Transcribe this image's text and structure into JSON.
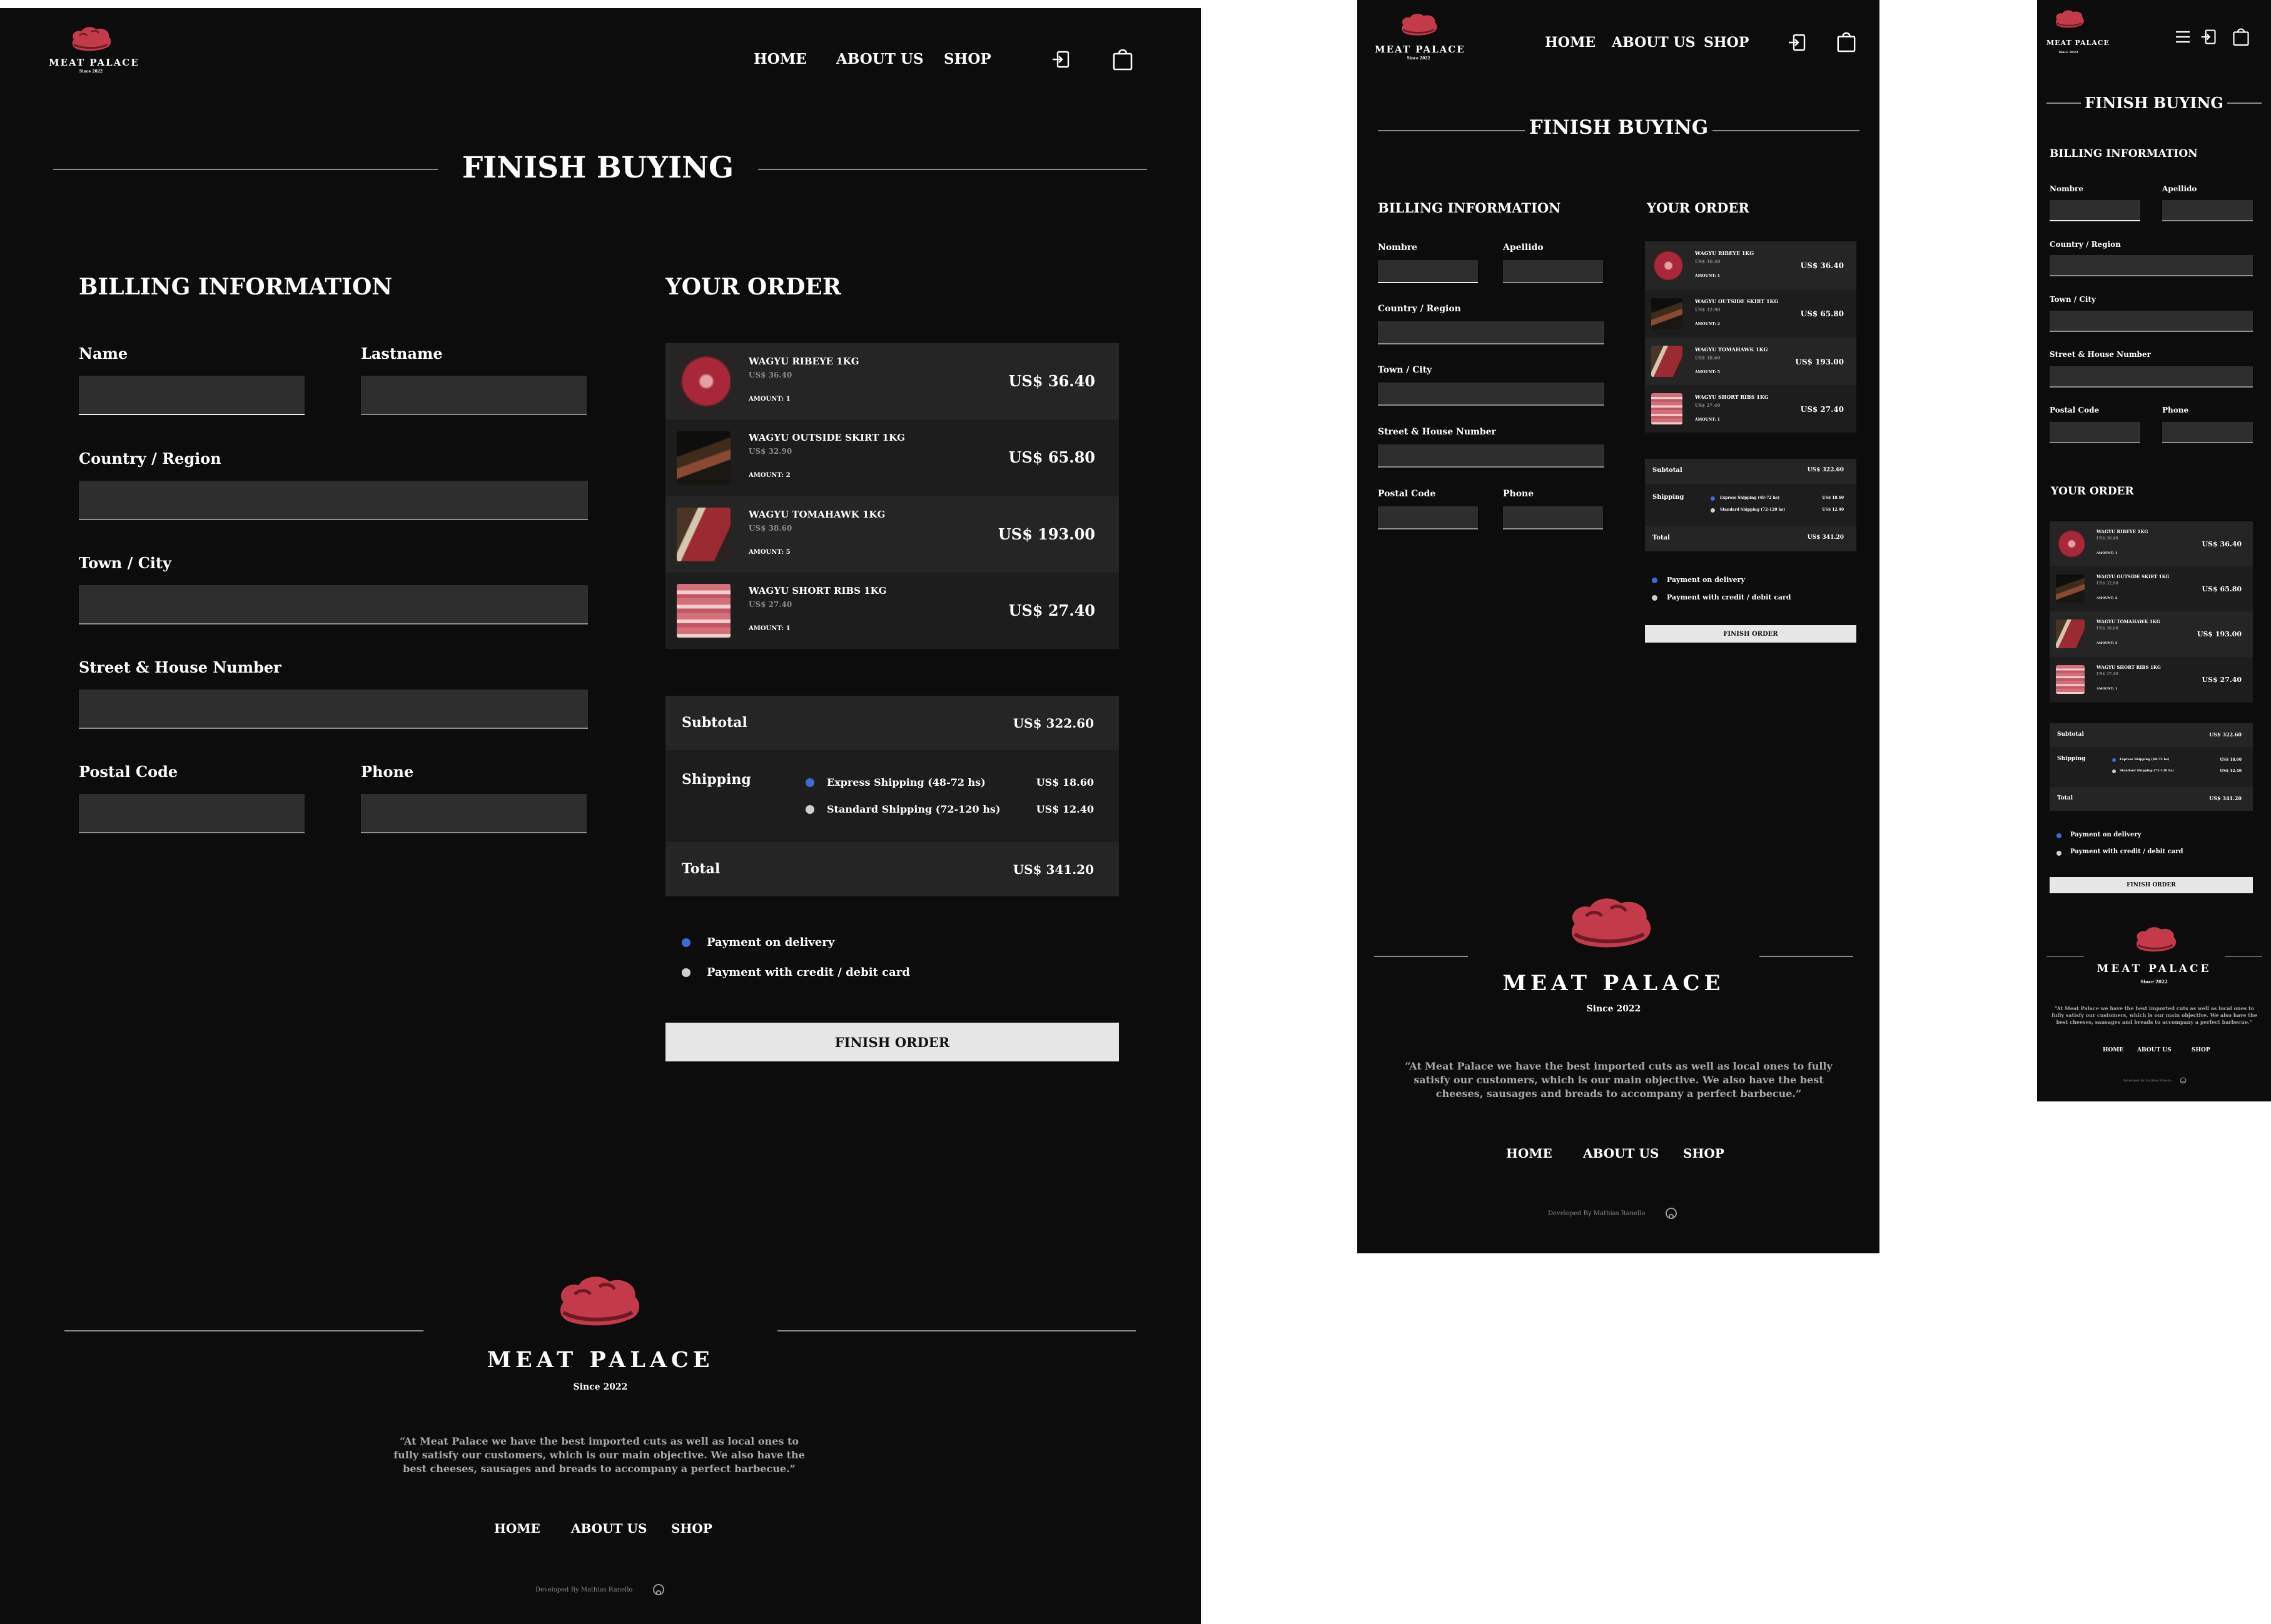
{
  "brand": {
    "name": "MEAT PALACE",
    "since": "Since 2022",
    "accent": "#c33b4b"
  },
  "nav": {
    "home": "HOME",
    "about": "ABOUT US",
    "shop": "SHOP"
  },
  "icons": {
    "login": "login-icon",
    "cart": "shopping-bag-icon",
    "menu": "hamburger-menu-icon",
    "github": "github-icon"
  },
  "page_title": "FINISH BUYING",
  "billing": {
    "heading": "BILLING INFORMATION",
    "first_name_label": "Name",
    "last_name_label": "Lastname",
    "first_name_label_small": "Nombre",
    "last_name_label_small": "Apellido",
    "country_label": "Country / Region",
    "city_label": "Town / City",
    "street_label": "Street & House Number",
    "postal_label": "Postal Code",
    "phone_label": "Phone"
  },
  "order": {
    "heading": "YOUR ORDER",
    "items": [
      {
        "name": "WAGYU RIBEYE 1KG",
        "unit_price": "US$ 36.40",
        "amount": "AMOUNT: 1",
        "total": "US$ 36.40",
        "thumb": "ribeye"
      },
      {
        "name": "WAGYU OUTSIDE SKIRT 1KG",
        "unit_price": "US$ 32.90",
        "amount": "AMOUNT: 2",
        "total": "US$ 65.80",
        "thumb": "skirt"
      },
      {
        "name": "WAGYU TOMAHAWK 1KG",
        "unit_price": "US$ 38.60",
        "amount": "AMOUNT: 5",
        "total": "US$ 193.00",
        "thumb": "tomahawk"
      },
      {
        "name": "WAGYU SHORT RIBS 1KG",
        "unit_price": "US$ 27.40",
        "amount": "AMOUNT: 1",
        "total": "US$ 27.40",
        "thumb": "shortrib"
      }
    ],
    "subtotal_label": "Subtotal",
    "subtotal_value": "US$ 322.60",
    "shipping_label": "Shipping",
    "shipping_options": [
      {
        "label": "Express Shipping (48-72 hs)",
        "price": "US$ 18.60",
        "selected": true
      },
      {
        "label": "Standard Shipping (72-120 hs)",
        "price": "US$ 12.40",
        "selected": false
      }
    ],
    "total_label": "Total",
    "total_value": "US$ 341.20",
    "payment_options": [
      {
        "label": "Payment on delivery",
        "selected": true
      },
      {
        "label": "Payment with credit / debit card",
        "selected": false
      }
    ],
    "finish_button": "FINISH ORDER"
  },
  "footer": {
    "quote": "“At Meat Palace we have the best imported cuts as well as local ones to fully satisfy our customers, which is our main objective. We also have the best cheeses, sausages and breads to accompany a perfect barbecue.”",
    "credit": "Developed By Mathias Ranello"
  }
}
